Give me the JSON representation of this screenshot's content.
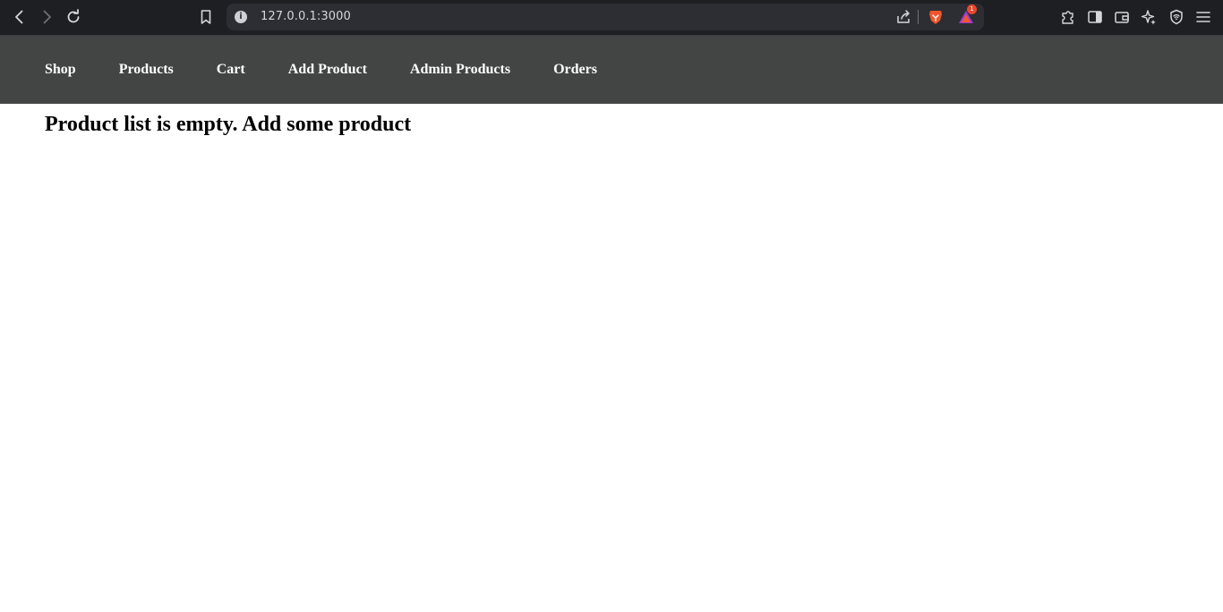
{
  "browser": {
    "url": "127.0.0.1:3000",
    "notification_count": "1",
    "icons": {
      "back": "back-arrow-icon",
      "forward": "forward-arrow-icon",
      "reload": "reload-icon",
      "bookmark": "bookmark-icon",
      "site_info": "info-icon",
      "share": "share-icon",
      "brave_shields": "brave-lion-icon",
      "brave_rewards": "rewards-triangle-icon",
      "extensions": "puzzle-icon",
      "sidebar": "sidebar-icon",
      "wallet": "wallet-icon",
      "leo": "sparkle-icon",
      "vpn": "vpn-shield-icon",
      "menu": "hamburger-menu-icon"
    }
  },
  "nav": {
    "items": [
      {
        "label": "Shop"
      },
      {
        "label": "Products"
      },
      {
        "label": "Cart"
      },
      {
        "label": "Add Product"
      },
      {
        "label": "Admin Products"
      },
      {
        "label": "Orders"
      }
    ]
  },
  "main": {
    "heading": "Product list is empty. Add some product"
  },
  "colors": {
    "browser_bar": "#1e1f22",
    "urlbar": "#2d2e33",
    "nav_background": "#434545",
    "nav_text": "#ffffff",
    "brave_orange": "#f1562b",
    "page_background": "#ffffff"
  }
}
